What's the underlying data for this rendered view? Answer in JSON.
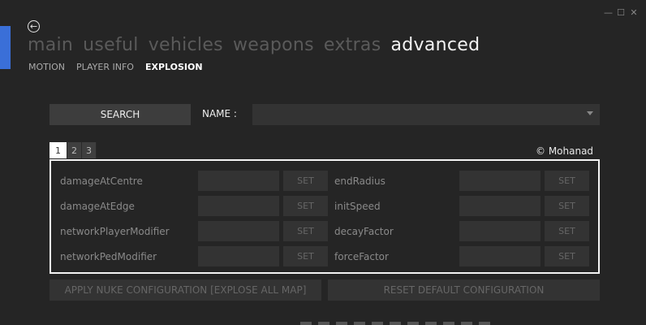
{
  "window": {
    "minimize": "—",
    "maximize": "☐",
    "close": "✕"
  },
  "nav": {
    "back_icon": "←",
    "main_tabs": [
      "main",
      "useful",
      "vehicles",
      "weapons",
      "extras",
      "advanced"
    ],
    "active_main_tab": "advanced",
    "sub_tabs": [
      "MOTION",
      "PLAYER INFO",
      "EXPLOSION"
    ],
    "active_sub_tab": "EXPLOSION"
  },
  "search": {
    "button_label": "SEARCH",
    "name_label": "NAME :",
    "name_value": ""
  },
  "pages": {
    "tabs": [
      "1",
      "2",
      "3"
    ],
    "active": "1"
  },
  "copyright": "© Mohanad",
  "params": {
    "left": [
      {
        "label": "damageAtCentre",
        "value": "",
        "set_label": "SET"
      },
      {
        "label": "damageAtEdge",
        "value": "",
        "set_label": "SET"
      },
      {
        "label": "networkPlayerModifier",
        "value": "",
        "set_label": "SET"
      },
      {
        "label": "networkPedModifier",
        "value": "",
        "set_label": "SET"
      }
    ],
    "right": [
      {
        "label": "endRadius",
        "value": "",
        "set_label": "SET"
      },
      {
        "label": "initSpeed",
        "value": "",
        "set_label": "SET"
      },
      {
        "label": "decayFactor",
        "value": "",
        "set_label": "SET"
      },
      {
        "label": "forceFactor",
        "value": "",
        "set_label": "SET"
      }
    ]
  },
  "actions": {
    "apply_nuke": "APPLY NUKE CONFIGURATION [EXPLOSE ALL MAP]",
    "reset_default": "RESET DEFAULT CONFIGURATION"
  },
  "colors": {
    "accent": "#3a6fd8",
    "background": "#252525"
  }
}
